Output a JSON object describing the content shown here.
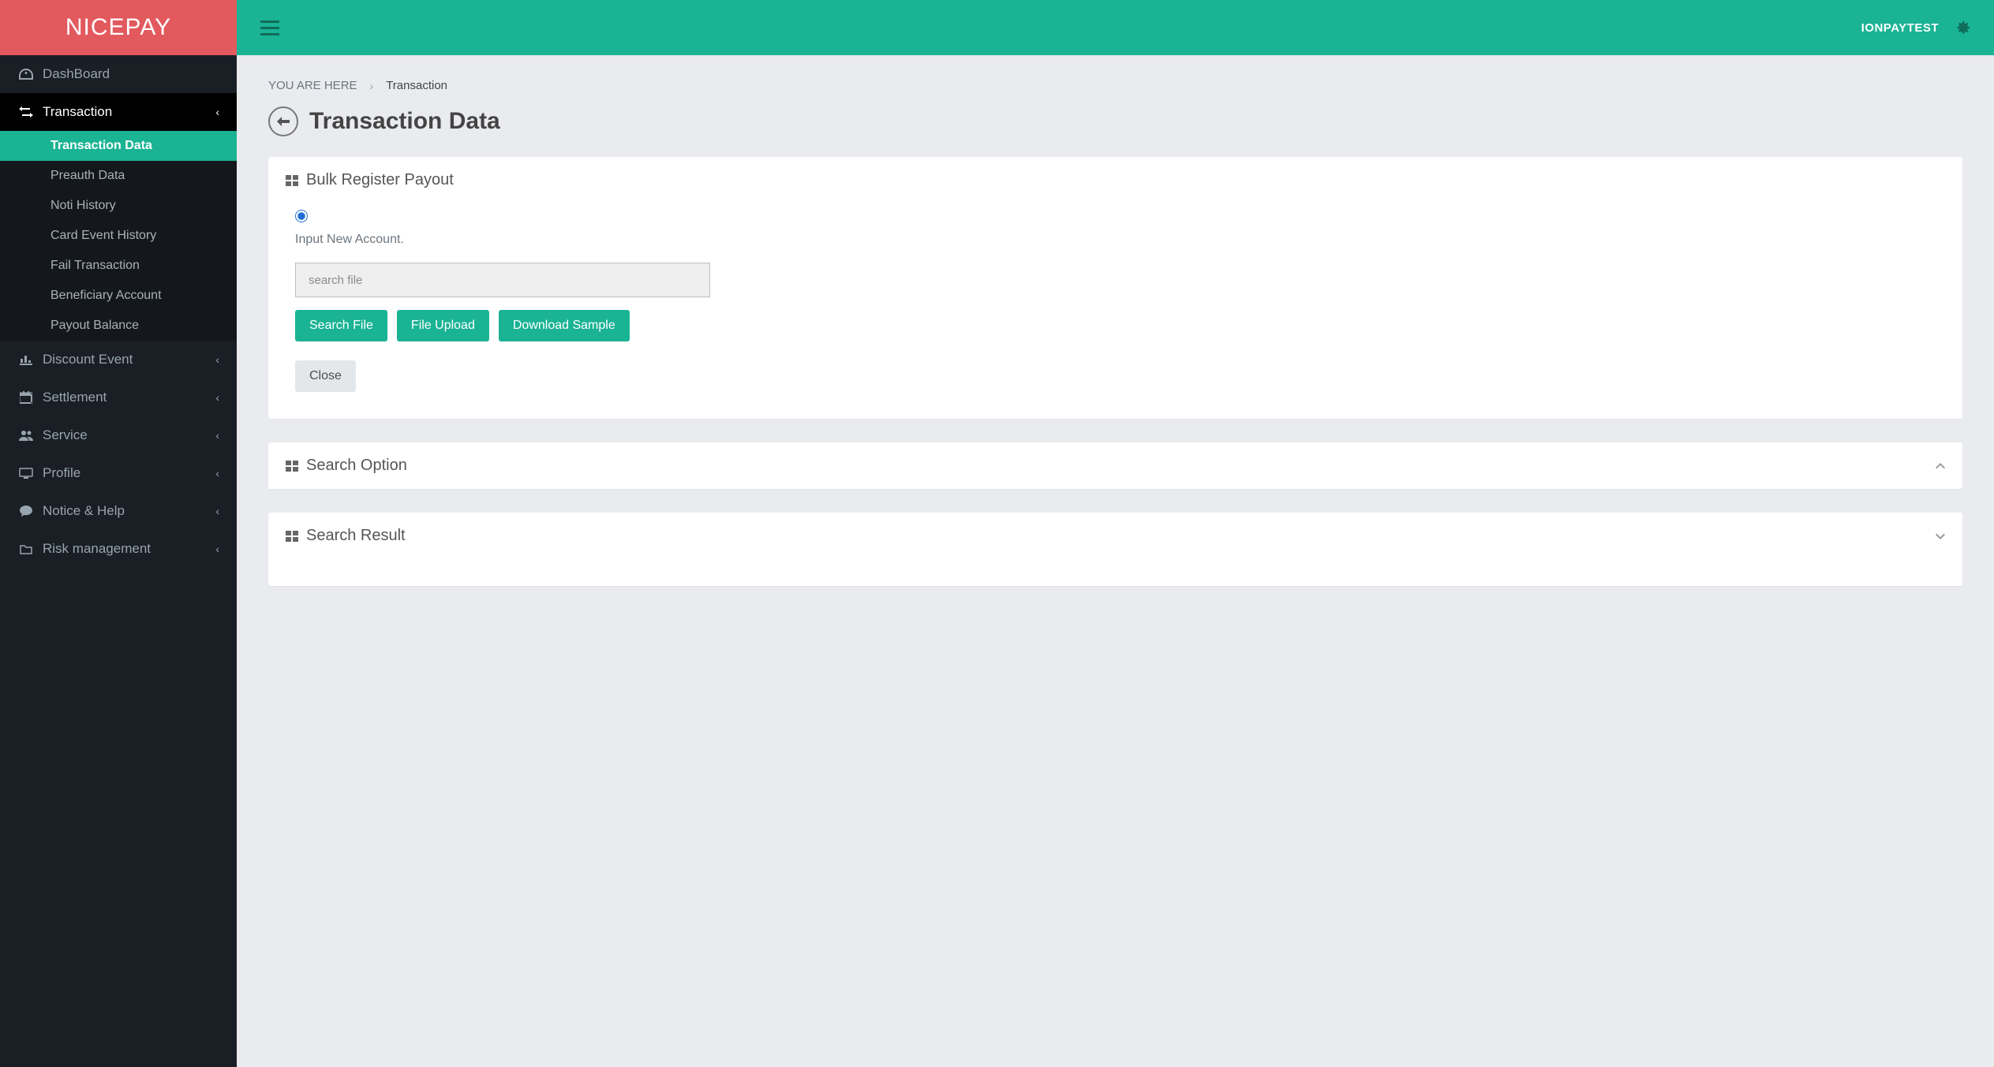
{
  "brand": "NICEPAY",
  "user": "IONPAYTEST",
  "breadcrumb": {
    "label": "YOU ARE HERE",
    "current": "Transaction"
  },
  "page_title": "Transaction Data",
  "sidebar": {
    "dashboard": "DashBoard",
    "transaction": "Transaction",
    "transaction_sub": {
      "transaction_data": "Transaction Data",
      "preauth_data": "Preauth Data",
      "noti_history": "Noti History",
      "card_event_history": "Card Event History",
      "fail_transaction": "Fail Transaction",
      "beneficiary_account": "Beneficiary Account",
      "payout_balance": "Payout Balance"
    },
    "discount_event": "Discount Event",
    "settlement": "Settlement",
    "service": "Service",
    "profile": "Profile",
    "notice_help": "Notice & Help",
    "risk_management": "Risk management"
  },
  "panels": {
    "bulk": {
      "title": "Bulk Register Payout",
      "radio_label": "Input New Account.",
      "search_placeholder": "search file",
      "btn_search_file": "Search File",
      "btn_file_upload": "File Upload",
      "btn_download_sample": "Download Sample",
      "btn_close": "Close"
    },
    "search_option": {
      "title": "Search Option"
    },
    "search_result": {
      "title": "Search Result"
    }
  }
}
